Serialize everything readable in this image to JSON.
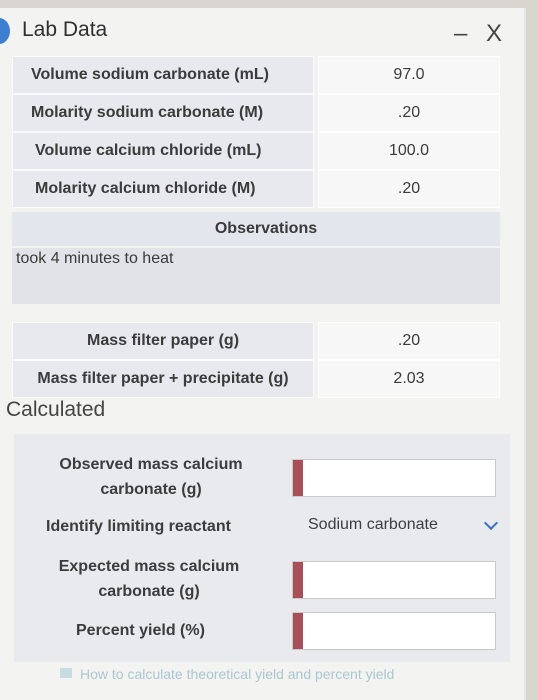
{
  "window": {
    "title": "Lab Data",
    "controls": "– X"
  },
  "lab_data": {
    "rows": [
      {
        "label": "Volume sodium carbonate (mL)",
        "value": "97.0"
      },
      {
        "label": "Molarity sodium carbonate (M)",
        "value": ".20"
      },
      {
        "label": "Volume calcium chloride (mL)",
        "value": "100.0"
      },
      {
        "label": "Molarity calcium chloride (M)",
        "value": ".20"
      }
    ]
  },
  "observations": {
    "header": "Observations",
    "text": "took 4 minutes to heat"
  },
  "mass_rows": [
    {
      "label": "Mass filter paper (g)",
      "value": ".20"
    },
    {
      "label": "Mass filter paper + precipitate (g)",
      "value": "2.03"
    }
  ],
  "calculated": {
    "title": "Calculated",
    "observed_mass_label_1": "Observed mass calcium",
    "observed_mass_label_2": "carbonate (g)",
    "observed_mass_value": "",
    "limiting_reactant_label": "Identify limiting reactant",
    "limiting_reactant_value": "Sodium carbonate",
    "expected_mass_label_1": "Expected mass calcium",
    "expected_mass_label_2": "carbonate (g)",
    "expected_mass_value": "",
    "percent_yield_label": "Percent yield (%)",
    "percent_yield_value": ""
  },
  "footer": {
    "link": "How to calculate theoretical yield and percent yield"
  },
  "colors": {
    "accent": "#a94f57",
    "chevron": "#3a73c4"
  }
}
